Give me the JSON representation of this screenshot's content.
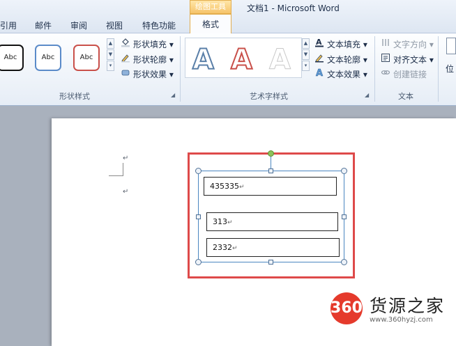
{
  "window": {
    "title": "文档1 - Microsoft Word"
  },
  "tabs": [
    {
      "label": "引用"
    },
    {
      "label": "邮件"
    },
    {
      "label": "审阅"
    },
    {
      "label": "视图"
    },
    {
      "label": "特色功能"
    }
  ],
  "contextual": {
    "group": "绘图工具",
    "tab": "格式"
  },
  "ribbon": {
    "shape_styles": {
      "label": "形状样式",
      "swatches": [
        "Abc",
        "Abc",
        "Abc"
      ],
      "commands": [
        {
          "label": "形状填充",
          "icon": "paint-bucket-icon",
          "arrow": "▾"
        },
        {
          "label": "形状轮廓",
          "icon": "pencil-icon",
          "arrow": "▾"
        },
        {
          "label": "形状效果",
          "icon": "shape-effects-icon",
          "arrow": "▾"
        }
      ]
    },
    "wordart_styles": {
      "label": "艺术字样式",
      "samples": [
        "A",
        "A",
        "A"
      ],
      "commands": [
        {
          "label": "文本填充",
          "icon": "text-fill-icon",
          "arrow": "▾"
        },
        {
          "label": "文本轮廓",
          "icon": "text-outline-icon",
          "arrow": "▾"
        },
        {
          "label": "文本效果",
          "icon": "text-effects-icon",
          "arrow": "▾"
        }
      ]
    },
    "text": {
      "label": "文本",
      "commands": [
        {
          "label": "文字方向",
          "icon": "text-direction-icon",
          "arrow": "▾",
          "enabled": false
        },
        {
          "label": "对齐文本",
          "icon": "align-text-icon",
          "arrow": "▾",
          "enabled": true
        },
        {
          "label": "创建链接",
          "icon": "link-icon",
          "arrow": "",
          "enabled": false
        }
      ]
    },
    "arrange": {
      "label_partial": "位"
    }
  },
  "document": {
    "paragraph_mark": "↵",
    "textboxes": [
      {
        "value": "435335"
      },
      {
        "value": "313"
      },
      {
        "value": "2332"
      }
    ]
  },
  "watermark": {
    "logo": "360",
    "name": "货源之家",
    "url": "www.360hyzj.com"
  },
  "colors": {
    "highlight": "#de4a4a",
    "context_tab": "#f6c46a",
    "selection": "#4a86c0",
    "logo": "#e53a2c"
  }
}
